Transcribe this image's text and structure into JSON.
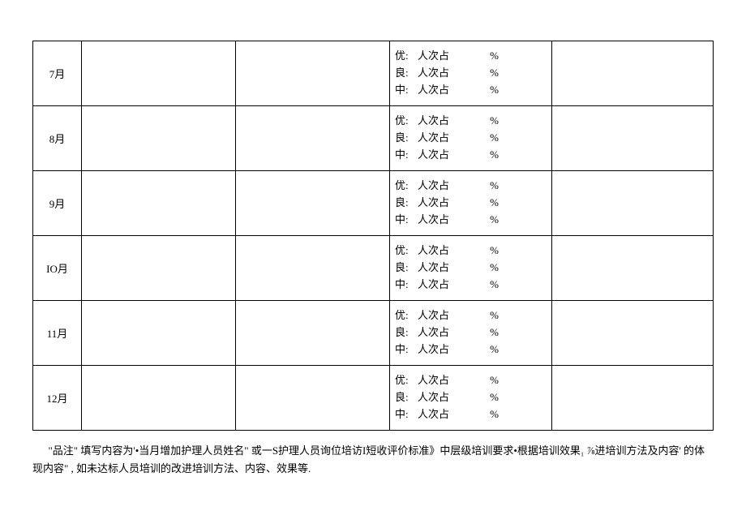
{
  "table": {
    "rating_lines": {
      "y": {
        "label": "优:",
        "mid": "人次占",
        "pct": "%"
      },
      "l": {
        "label": "良:",
        "mid": "人次占",
        "pct": "%"
      },
      "z": {
        "label": "中:",
        "mid": "人次占",
        "pct": "%"
      }
    },
    "rows": [
      {
        "month": "7月"
      },
      {
        "month": "8月"
      },
      {
        "month": "9月"
      },
      {
        "month": "IO月"
      },
      {
        "month": "11月"
      },
      {
        "month": "12月"
      }
    ]
  },
  "footnote": "\"品注\" 填写内容为'•当月增加护理人员姓名\" 或一S护理人员询位培访I短收评价标准》中层级培训要求•根据培训效果₁ ⅞进培训方法及内容' 的体现内容\" , 如未达标人员培训的改进培训方法、内容、效果等."
}
